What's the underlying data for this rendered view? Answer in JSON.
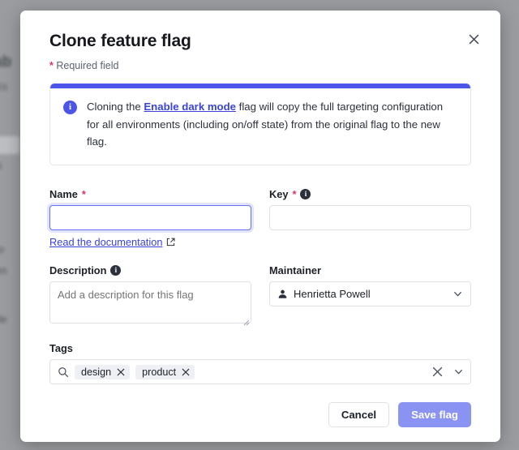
{
  "background": {
    "lines": [
      "ab",
      "Ks",
      "lis",
      "to",
      "en",
      "de"
    ]
  },
  "dialog": {
    "title": "Clone feature flag",
    "close_icon": "close-icon",
    "required_note_star": "*",
    "required_note": "Required field",
    "banner": {
      "icon": "info-icon",
      "text_before": "Cloning the ",
      "link": "Enable dark mode",
      "text_after": " flag will copy the full targeting configuration for all environments (including on/off state) from the original flag to the new flag."
    },
    "fields": {
      "name": {
        "label": "Name",
        "required_star": "*",
        "value": "",
        "placeholder": "",
        "doc_link": "Read the documentation",
        "doc_link_icon": "external-link-icon"
      },
      "key": {
        "label": "Key",
        "required_star": "*",
        "info_icon": "i",
        "value": "",
        "placeholder": ""
      },
      "description": {
        "label": "Description",
        "info_icon": "i",
        "value": "",
        "placeholder": "Add a description for this flag"
      },
      "maintainer": {
        "label": "Maintainer",
        "avatar_icon": "person-icon",
        "selected": "Henrietta Powell",
        "caret_icon": "chevron-down-icon"
      },
      "tags": {
        "label": "Tags",
        "search_icon": "search-icon",
        "chips": [
          "design",
          "product"
        ],
        "clear_icon": "close-icon",
        "caret_icon": "chevron-down-icon"
      }
    },
    "footer": {
      "cancel_label": "Cancel",
      "save_label": "Save flag"
    }
  },
  "colors": {
    "accent": "#4b56e8",
    "link": "#3a44d6",
    "required": "#d6336c",
    "save_button": "#8b93f2",
    "backdrop": "#8e9194",
    "chip_bg": "#eef0f3"
  }
}
